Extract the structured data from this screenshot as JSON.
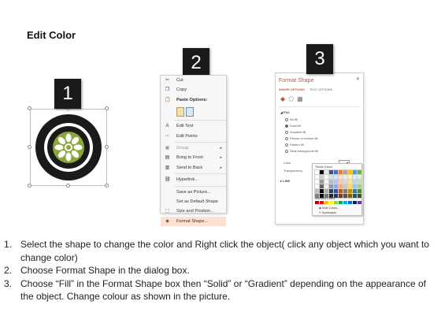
{
  "title": "Edit Color",
  "badges": [
    "1",
    "2",
    "3"
  ],
  "context_menu": {
    "items": [
      {
        "label": "Cut",
        "icon": "scissors-icon",
        "glyph": "✂"
      },
      {
        "label": "Copy",
        "icon": "copy-icon",
        "glyph": "❐"
      },
      {
        "label": "Paste Options:",
        "icon": "paste-icon",
        "glyph": "📋"
      },
      {
        "label": "Edit Text",
        "icon": "edit-text-icon",
        "glyph": "A"
      },
      {
        "label": "Edit Points",
        "icon": "edit-points-icon",
        "glyph": "⋯"
      },
      {
        "label": "Group",
        "icon": "group-icon",
        "glyph": "▣"
      },
      {
        "label": "Bring to Front",
        "icon": "bring-front-icon",
        "glyph": "▤"
      },
      {
        "label": "Send to Back",
        "icon": "send-back-icon",
        "glyph": "▥"
      },
      {
        "label": "Hyperlink...",
        "icon": "hyperlink-icon",
        "glyph": "⛓"
      },
      {
        "label": "Save as Picture...",
        "icon": "",
        "glyph": ""
      },
      {
        "label": "Set as Default Shape",
        "icon": "",
        "glyph": ""
      },
      {
        "label": "Size and Position...",
        "icon": "size-position-icon",
        "glyph": "⬚"
      },
      {
        "label": "Format Shape...",
        "icon": "format-shape-icon",
        "glyph": "◈"
      }
    ]
  },
  "format_pane": {
    "title": "Format Shape",
    "close": "✕",
    "tabs": [
      "SHAPE OPTIONS",
      "TEXT OPTIONS"
    ],
    "fill_section": "FILL",
    "fill_options": [
      "No fill",
      "Solid fill",
      "Gradient fill",
      "Picture or texture fill",
      "Pattern fill",
      "Slide background fill"
    ],
    "selected_fill": "Solid fill",
    "color_label": "Color",
    "transparency_label": "Transparency",
    "line_section": "LINE"
  },
  "palette": {
    "theme_label": "Theme Colors",
    "standard_label": "Standard Colors",
    "more_colors": "More Colors...",
    "eyedropper": "Eyedropper",
    "theme_top": [
      "#ffffff",
      "#000000",
      "#e7e6e6",
      "#44546a",
      "#4472c4",
      "#ed7d31",
      "#a5a5a5",
      "#ffc000",
      "#5b9bd5",
      "#70ad47"
    ],
    "standard": [
      "#c00000",
      "#ff0000",
      "#ffc000",
      "#ffff00",
      "#92d050",
      "#00b050",
      "#00b0f0",
      "#0070c0",
      "#002060",
      "#7030a0"
    ]
  },
  "steps": [
    {
      "num": "1.",
      "text": "Select the shape to change the color and Right click the object( click any object which you want to change color)"
    },
    {
      "num": "2.",
      "text": "Choose Format Shape in the dialog box."
    },
    {
      "num": "3.",
      "text": "Choose “Fill” in the Format Shape box then “Solid” or “Gradient” depending on the appearance of the object. Change colour as shown in the picture."
    }
  ],
  "colors": {
    "accent": "#c55a30",
    "tire": "#1a1a1a",
    "rim": "#8aa83a",
    "menu_highlight": "#fde1d3"
  }
}
